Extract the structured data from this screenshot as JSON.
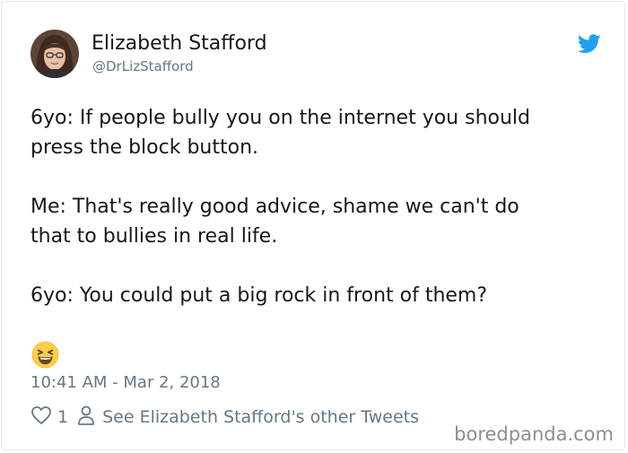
{
  "tweet": {
    "author_name": "Elizabeth Stafford",
    "author_handle": "@DrLizStafford",
    "lines": [
      "6yo: If people bully you on the internet you should",
      "press the block button.",
      "Me: That's really good advice, shame we can't do",
      "that to bullies in real life.",
      "6yo: You could put a big rock in front of them?"
    ],
    "emoji": "laughing-face-emoji",
    "timestamp": "10:41 AM - Mar 2, 2018",
    "like_count": "1",
    "see_other_tweets": "See Elizabeth Stafford's other Tweets"
  },
  "icons": {
    "brand": "twitter-bird-icon",
    "like": "heart-icon",
    "profile": "person-icon"
  },
  "colors": {
    "brand": "#1da1f2",
    "muted_text": "#657786",
    "body_text": "#14171a",
    "border": "#e1e8ed"
  },
  "watermark": "boredpanda.com"
}
